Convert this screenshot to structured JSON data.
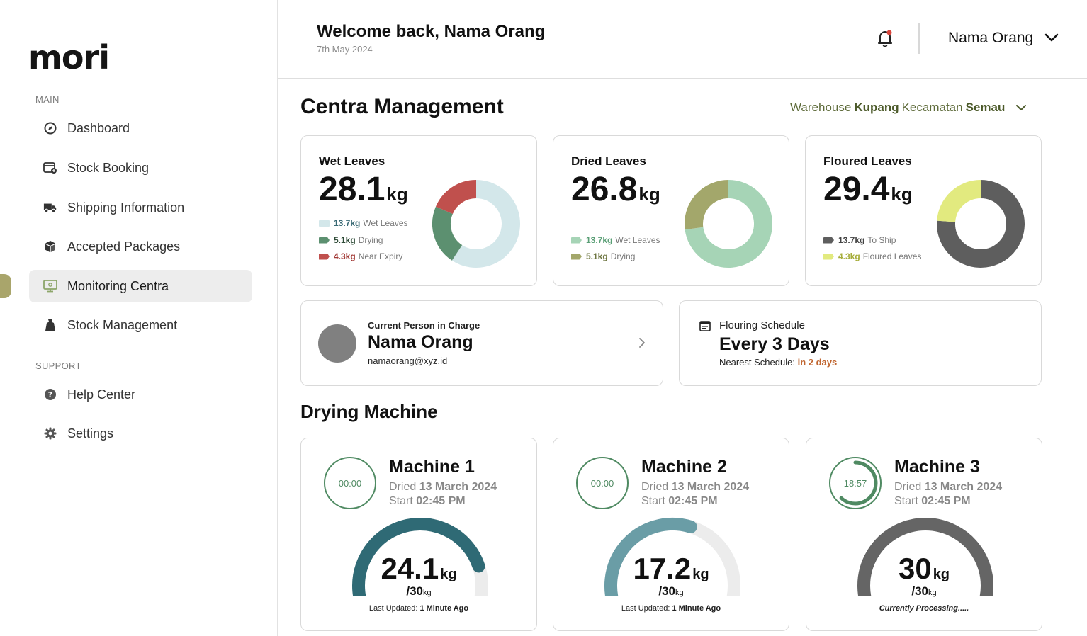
{
  "sidebar": {
    "logo": "mori",
    "main_label": "MAIN",
    "support_label": "SUPPORT",
    "items": [
      {
        "label": "Dashboard",
        "icon": "dashboard-compass-icon"
      },
      {
        "label": "Stock Booking",
        "icon": "calendar-plus-icon"
      },
      {
        "label": "Shipping Information",
        "icon": "truck-icon"
      },
      {
        "label": "Accepted Packages",
        "icon": "package-icon"
      },
      {
        "label": "Monitoring Centra",
        "icon": "monitor-icon",
        "active": true
      },
      {
        "label": "Stock Management",
        "icon": "stock-bag-icon"
      }
    ],
    "support_items": [
      {
        "label": "Help Center",
        "icon": "help-icon"
      },
      {
        "label": "Settings",
        "icon": "gear-icon"
      }
    ]
  },
  "header": {
    "welcome": "Welcome back, Nama Orang",
    "date": "7th May 2024",
    "user_name": "Nama Orang"
  },
  "page": {
    "title": "Centra Management",
    "warehouse_prefix": "Warehouse",
    "warehouse_name": "Kupang",
    "kecamatan_prefix": "Kecamatan",
    "kecamatan_name": "Semau"
  },
  "stats": [
    {
      "title": "Wet Leaves",
      "value": "28.1",
      "unit": "kg",
      "legend": [
        {
          "amount": "13.7kg",
          "label": "Wet Leaves",
          "color": "#d3e7ea",
          "text_color": "#3a6a75"
        },
        {
          "amount": "5.1kg",
          "label": "Drying",
          "color": "#5c9070",
          "text_color": "#2d4a36"
        },
        {
          "amount": "4.3kg",
          "label": "Near Expiry",
          "color": "#c0504d",
          "text_color": "#a23a36"
        }
      ]
    },
    {
      "title": "Dried Leaves",
      "value": "26.8",
      "unit": "kg",
      "legend": [
        {
          "amount": "13.7kg",
          "label": "Wet Leaves",
          "color": "#a6d4b6",
          "text_color": "#5a9f76"
        },
        {
          "amount": "5.1kg",
          "label": "Drying",
          "color": "#a3a76b",
          "text_color": "#6d7540"
        }
      ]
    },
    {
      "title": "Floured Leaves",
      "value": "29.4",
      "unit": "kg",
      "legend": [
        {
          "amount": "13.7kg",
          "label": "To Ship",
          "color": "#5e5e5e",
          "text_color": "#444444"
        },
        {
          "amount": "4.3kg",
          "label": "Floured Leaves",
          "color": "#e2ea7f",
          "text_color": "#a6ad3a"
        }
      ]
    }
  ],
  "person": {
    "label": "Current Person in Charge",
    "name": "Nama Orang",
    "email": "namaorang@xyz.id"
  },
  "schedule": {
    "label": "Flouring Schedule",
    "value": "Every 3 Days",
    "nearest_label": "Nearest Schedule:",
    "nearest_value": "in 2 days"
  },
  "drying": {
    "title": "Drying Machine",
    "dried_label": "Dried",
    "start_label": "Start",
    "machines": [
      {
        "name": "Machine 1",
        "timer": "00:00",
        "timer_progress": 0,
        "dried_date": "13 March 2024",
        "start_time": "02:45 PM",
        "value": "24.1",
        "max": "30",
        "unit": "kg",
        "footer_label": "Last Updated:",
        "footer_value": "1 Minute Ago",
        "fill_color": "#2f6a75",
        "fill_ratio": 0.803
      },
      {
        "name": "Machine 2",
        "timer": "00:00",
        "timer_progress": 0,
        "dried_date": "13 March 2024",
        "start_time": "02:45 PM",
        "value": "17.2",
        "max": "30",
        "unit": "kg",
        "footer_label": "Last Updated:",
        "footer_value": "1 Minute Ago",
        "fill_color": "#6a9da6",
        "fill_ratio": 0.573
      },
      {
        "name": "Machine 3",
        "timer": "18:57",
        "timer_progress": 0.62,
        "dried_date": "13 March 2024",
        "start_time": "02:45 PM",
        "value": "30",
        "max": "30",
        "unit": "kg",
        "footer_label": "",
        "footer_value": "Currently Processing.....",
        "fill_color": "#656565",
        "fill_ratio": 1.0
      }
    ]
  }
}
